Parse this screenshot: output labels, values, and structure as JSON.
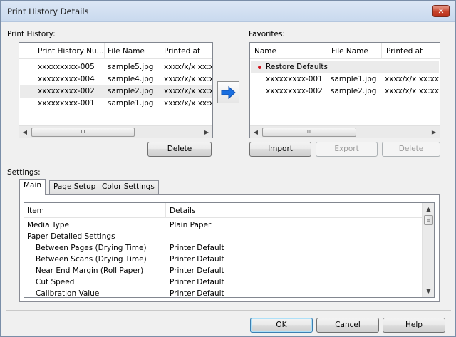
{
  "window": {
    "title": "Print History Details",
    "close_glyph": "✕"
  },
  "history": {
    "label": "Print History:",
    "columns": [
      "Print History Nu...",
      "File Name",
      "Printed at"
    ],
    "rows": [
      {
        "id": "xxxxxxxxx-005",
        "file": "sample5.jpg",
        "printed": "xxxx/x/x xx:xx"
      },
      {
        "id": "xxxxxxxxx-004",
        "file": "sample4.jpg",
        "printed": "xxxx/x/x xx:xx"
      },
      {
        "id": "xxxxxxxxx-002",
        "file": "sample2.jpg",
        "printed": "xxxx/x/x xx:xx"
      },
      {
        "id": "xxxxxxxxx-001",
        "file": "sample1.jpg",
        "printed": "xxxx/x/x xx:xx"
      }
    ],
    "delete_label": "Delete",
    "scroll_grip": "III"
  },
  "favorites": {
    "label": "Favorites:",
    "columns": [
      "Name",
      "File Name",
      "Printed at"
    ],
    "rows": [
      {
        "name": "Restore Defaults",
        "file": "",
        "printed": ""
      },
      {
        "name": "xxxxxxxxx-001",
        "file": "sample1.jpg",
        "printed": "xxxx/x/x xx:xx"
      },
      {
        "name": "xxxxxxxxx-002",
        "file": "sample2.jpg",
        "printed": "xxxx/x/x xx:xx"
      }
    ],
    "import_label": "Import",
    "export_label": "Export",
    "delete_label": "Delete",
    "scroll_grip": "III"
  },
  "settings": {
    "label": "Settings:",
    "tabs": [
      "Main",
      "Page Setup",
      "Color Settings"
    ],
    "columns": [
      "Item",
      "Details"
    ],
    "rows": [
      {
        "item": "Media Type",
        "details": "Plain Paper"
      },
      {
        "item": "Paper Detailed Settings",
        "details": ""
      },
      {
        "item": "Between Pages (Drying Time)",
        "details": "Printer Default"
      },
      {
        "item": "Between Scans (Drying Time)",
        "details": "Printer Default"
      },
      {
        "item": "Near End Margin (Roll Paper)",
        "details": "Printer Default"
      },
      {
        "item": "Cut Speed",
        "details": "Printer Default"
      },
      {
        "item": "Calibration Value",
        "details": "Printer Default"
      }
    ]
  },
  "footer": {
    "ok_label": "OK",
    "cancel_label": "Cancel",
    "help_label": "Help"
  },
  "colors": {
    "accent_arrow": "#1a6fe0",
    "bullet": "#d0141e"
  }
}
